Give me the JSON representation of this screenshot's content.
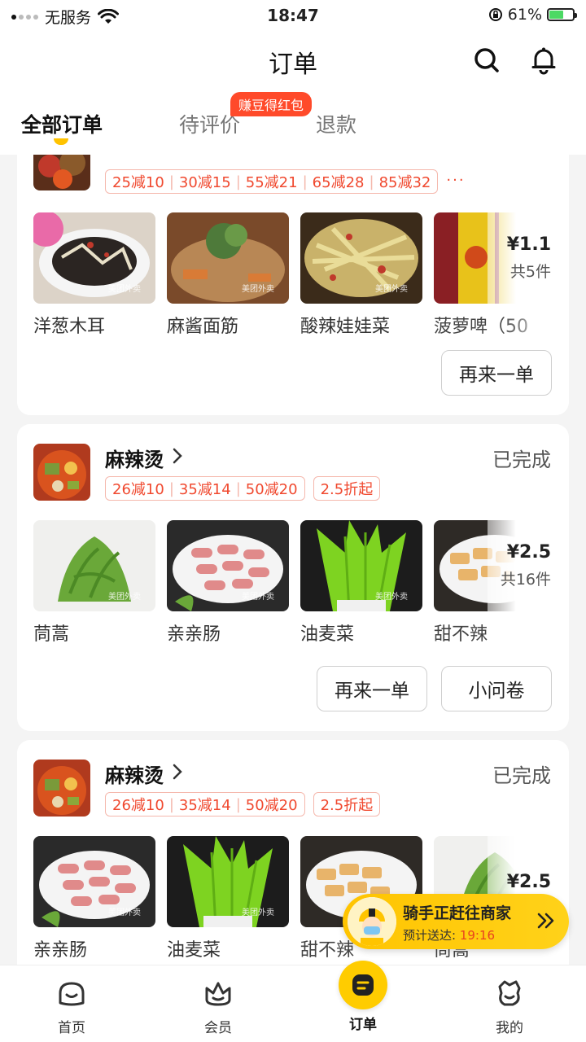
{
  "status_bar": {
    "carrier": "无服务",
    "time": "18:47",
    "battery": "61%"
  },
  "header": {
    "title": "订单"
  },
  "tabs": [
    {
      "label": "全部订单"
    },
    {
      "label": "待评价"
    },
    {
      "label": "退款"
    }
  ],
  "promo_badge": "赚豆得红包",
  "orders": [
    {
      "tags": [
        "25减10",
        "30减15",
        "55减21",
        "65减28",
        "85减32"
      ],
      "more": "···",
      "items": [
        "洋葱木耳",
        "麻酱面筋",
        "酸辣娃娃菜",
        "菠萝啤（50"
      ],
      "price": "¥1.1",
      "count": "共5件",
      "buttons": [
        "再来一单"
      ]
    },
    {
      "shop": "麻辣烫",
      "status": "已完成",
      "tags": [
        "26减10",
        "35减14",
        "50减20"
      ],
      "extra_tag": "2.5折起",
      "items": [
        "茼蒿",
        "亲亲肠",
        "油麦菜",
        "甜不辣"
      ],
      "price": "¥2.5",
      "count": "共16件",
      "buttons": [
        "再来一单",
        "小问卷"
      ]
    },
    {
      "shop": "麻辣烫",
      "status": "已完成",
      "tags": [
        "26减10",
        "35减14",
        "50减20"
      ],
      "extra_tag": "2.5折起",
      "items": [
        "亲亲肠",
        "油麦菜",
        "甜不辣",
        "茼蒿"
      ],
      "price": "¥2.5"
    }
  ],
  "watermark": "美团外卖",
  "rider": {
    "title": "骑手正赶往商家",
    "eta_label": "预计送达:",
    "eta_time": "19:16"
  },
  "bottom_nav": [
    {
      "label": "首页"
    },
    {
      "label": "会员"
    },
    {
      "label": "订单"
    },
    {
      "label": "我的"
    }
  ],
  "colors": {
    "accent": "#ffc300",
    "promo": "#ff4a2a",
    "tag_text": "#f0492f"
  }
}
